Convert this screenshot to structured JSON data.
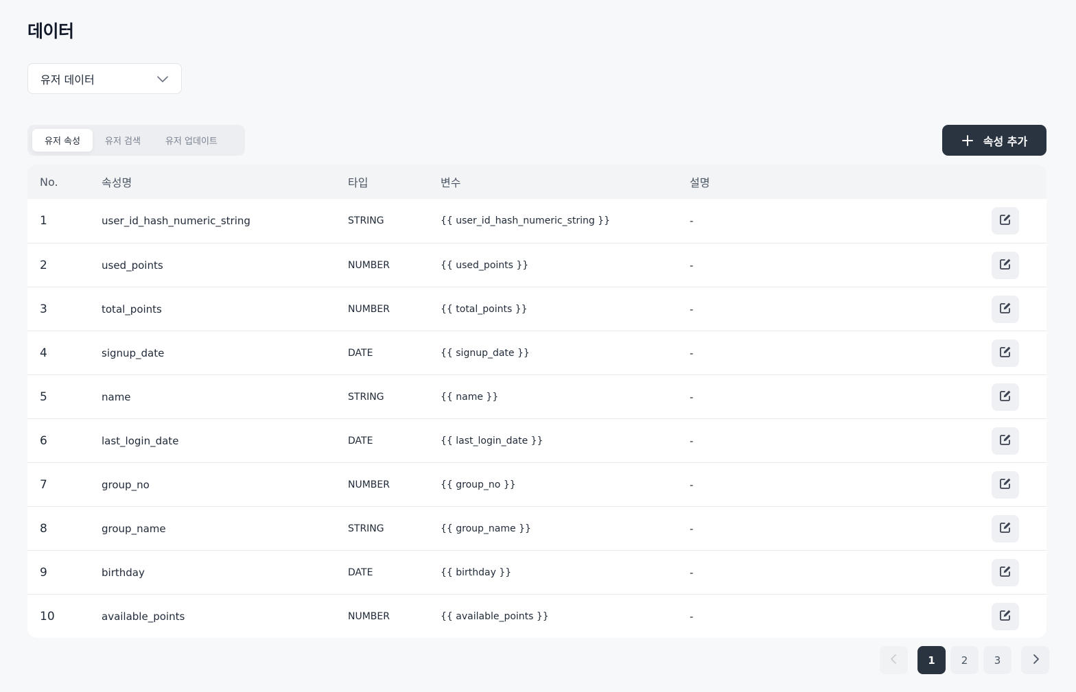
{
  "page": {
    "title": "데이터"
  },
  "selector": {
    "value": "유저 데이터"
  },
  "tabs": [
    {
      "label": "유저 속성",
      "active": true
    },
    {
      "label": "유저 검색",
      "active": false
    },
    {
      "label": "유저 업데이트",
      "active": false
    }
  ],
  "add_button": {
    "label": "속성 추가"
  },
  "table": {
    "headers": {
      "no": "No.",
      "name": "속성명",
      "type": "타입",
      "variable": "변수",
      "description": "설명"
    },
    "rows": [
      {
        "no": "1",
        "name": "user_id_hash_numeric_string",
        "type": "STRING",
        "variable": "{{ user_id_hash_numeric_string }}",
        "description": "-"
      },
      {
        "no": "2",
        "name": "used_points",
        "type": "NUMBER",
        "variable": "{{ used_points }}",
        "description": "-"
      },
      {
        "no": "3",
        "name": "total_points",
        "type": "NUMBER",
        "variable": "{{ total_points }}",
        "description": "-"
      },
      {
        "no": "4",
        "name": "signup_date",
        "type": "DATE",
        "variable": "{{ signup_date }}",
        "description": "-"
      },
      {
        "no": "5",
        "name": "name",
        "type": "STRING",
        "variable": "{{ name }}",
        "description": "-"
      },
      {
        "no": "6",
        "name": "last_login_date",
        "type": "DATE",
        "variable": "{{ last_login_date }}",
        "description": "-"
      },
      {
        "no": "7",
        "name": "group_no",
        "type": "NUMBER",
        "variable": "{{ group_no }}",
        "description": "-"
      },
      {
        "no": "8",
        "name": "group_name",
        "type": "STRING",
        "variable": "{{ group_name }}",
        "description": "-"
      },
      {
        "no": "9",
        "name": "birthday",
        "type": "DATE",
        "variable": "{{ birthday }}",
        "description": "-"
      },
      {
        "no": "10",
        "name": "available_points",
        "type": "NUMBER",
        "variable": "{{ available_points }}",
        "description": "-"
      }
    ]
  },
  "pagination": {
    "pages": [
      "1",
      "2",
      "3"
    ],
    "current": "1"
  },
  "colors": {
    "primary": "#2a3441",
    "background": "#f7f8fa",
    "surface": "#ffffff"
  },
  "icons": {
    "select": "chevron-down-icon",
    "add": "plus-icon",
    "edit": "edit-icon",
    "prev": "chevron-left-icon",
    "next": "chevron-right-icon"
  }
}
